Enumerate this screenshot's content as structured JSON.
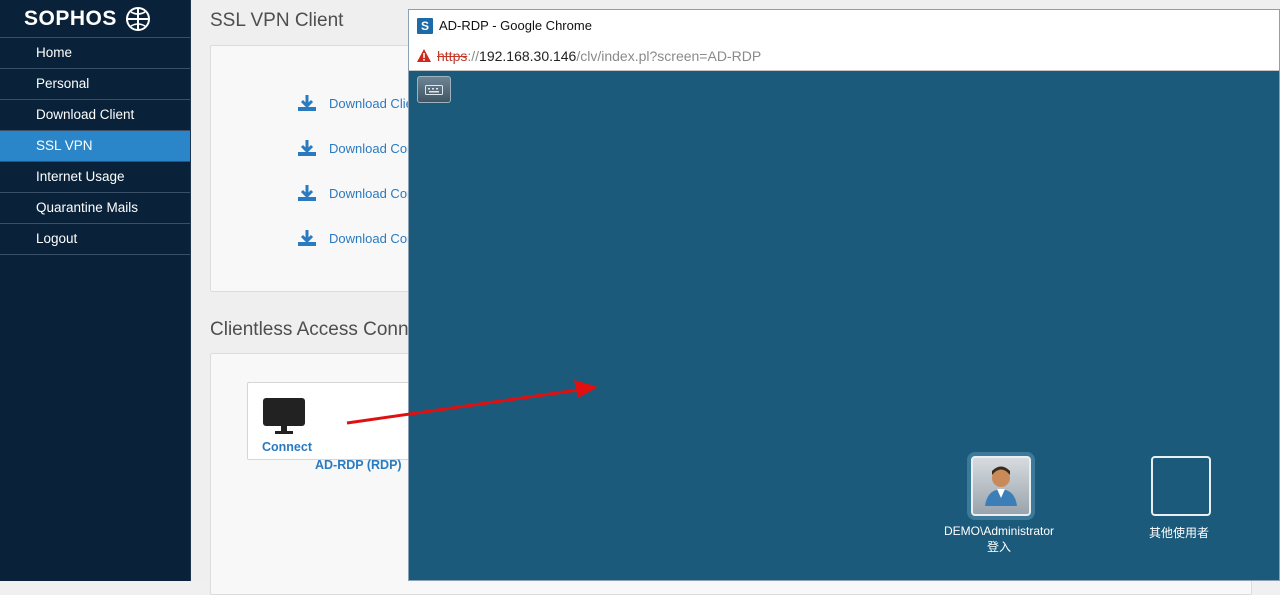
{
  "sidebar": {
    "brand": "SOPHOS",
    "items": [
      {
        "label": "Home"
      },
      {
        "label": "Personal"
      },
      {
        "label": "Download Client"
      },
      {
        "label": "SSL VPN",
        "active": true
      },
      {
        "label": "Internet Usage"
      },
      {
        "label": "Quarantine Mails"
      },
      {
        "label": "Logout"
      }
    ]
  },
  "main": {
    "ssl_vpn_title": "SSL VPN Client",
    "downloads": [
      {
        "label": "Download Clie"
      },
      {
        "label": "Download Cor"
      },
      {
        "label": "Download Cor"
      },
      {
        "label": "Download Cor"
      }
    ],
    "clientless_title": "Clientless Access Conn",
    "connect_label": "Connect",
    "connection_name": "AD-RDP (RDP)"
  },
  "popup": {
    "window_title": "AD-RDP - Google Chrome",
    "favicon_letter": "S",
    "url_scheme": "https",
    "url_sep": "://",
    "url_host": "192.168.30.146",
    "url_path": "/clv/index.pl?screen=AD-RDP",
    "users": [
      {
        "name": "DEMO\\Administrator",
        "action": "登入"
      },
      {
        "name": "其他使用者",
        "action": ""
      }
    ]
  },
  "colors": {
    "sidebar_bg": "#0a2239",
    "active_item": "#2a86c8",
    "link_blue": "#2a7ac0",
    "rdp_bg": "#1b5a7b",
    "arrow_red": "#e01010"
  },
  "icons": {
    "download": "download-icon",
    "monitor": "monitor-icon",
    "warning": "warning-icon",
    "keyboard": "keyboard-icon",
    "user": "user-avatar-icon"
  }
}
